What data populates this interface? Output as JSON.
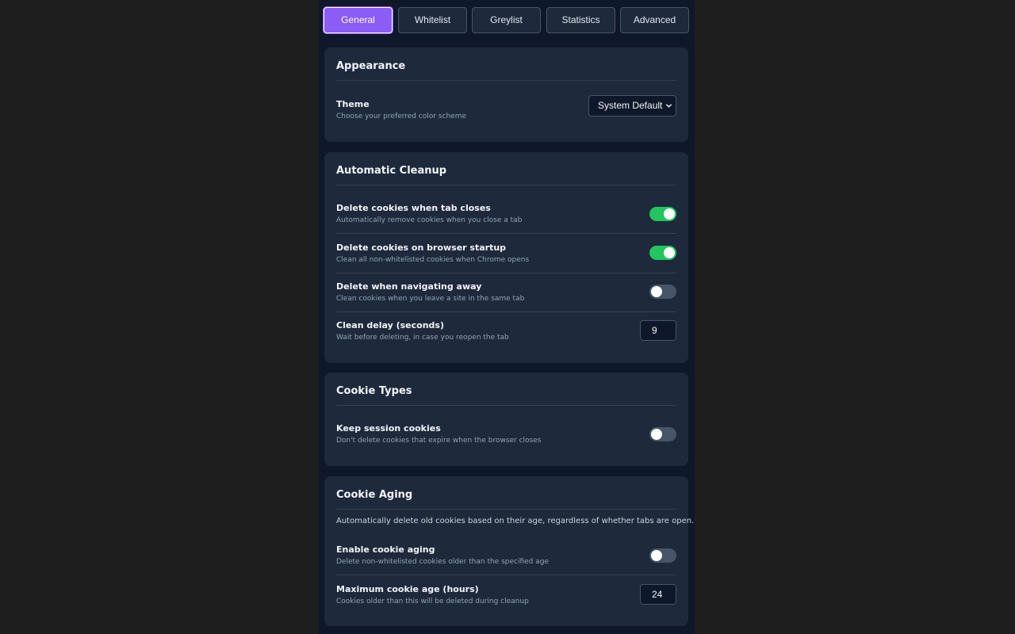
{
  "tabs": [
    {
      "label": "General",
      "active": true
    },
    {
      "label": "Whitelist",
      "active": false
    },
    {
      "label": "Greylist",
      "active": false
    },
    {
      "label": "Statistics",
      "active": false
    },
    {
      "label": "Advanced",
      "active": false
    }
  ],
  "appearance": {
    "title": "Appearance",
    "theme": {
      "label": "Theme",
      "description": "Choose your preferred color scheme",
      "value": "System Default"
    }
  },
  "cleanup": {
    "title": "Automatic Cleanup",
    "tab_close": {
      "label": "Delete cookies when tab closes",
      "description": "Automatically remove cookies when you close a tab",
      "enabled": true
    },
    "startup": {
      "label": "Delete cookies on browser startup",
      "description": "Clean all non-whitelisted cookies when Chrome opens",
      "enabled": true
    },
    "navigate": {
      "label": "Delete when navigating away",
      "description": "Clean cookies when you leave a site in the same tab",
      "enabled": false
    },
    "delay": {
      "label": "Clean delay (seconds)",
      "description": "Wait before deleting, in case you reopen the tab",
      "value": "9"
    }
  },
  "cookie_types": {
    "title": "Cookie Types",
    "session": {
      "label": "Keep session cookies",
      "description": "Don't delete cookies that expire when the browser closes",
      "enabled": false
    }
  },
  "aging": {
    "title": "Cookie Aging",
    "intro": "Automatically delete old cookies based on their age, regardless of whether tabs are open.",
    "enable": {
      "label": "Enable cookie aging",
      "description": "Delete non-whitelisted cookies older than the specified age",
      "enabled": false
    },
    "max_age": {
      "label": "Maximum cookie age (hours)",
      "description": "Cookies older than this will be deleted during cleanup",
      "value": "24"
    }
  },
  "colors": {
    "accent": "#8b5cf6",
    "toggle_on": "#22c55e",
    "toggle_off": "#475569",
    "panel": "#1e293b",
    "background": "#0f172a"
  },
  "icons": {
    "select_chevron": "chevron-down-icon"
  }
}
